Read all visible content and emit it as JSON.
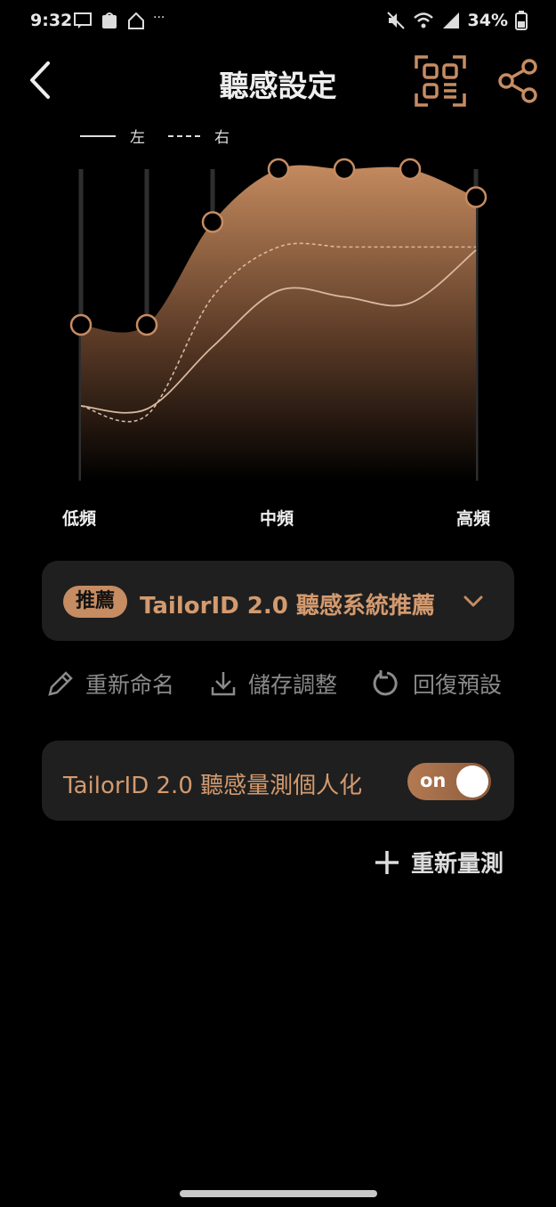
{
  "status_bar": {
    "time": "9:32",
    "ellipsis": "···",
    "battery": "34%"
  },
  "header": {
    "title": "聽感設定"
  },
  "legend": {
    "left": "左",
    "right": "右"
  },
  "chart_labels": {
    "low": "低頻",
    "mid": "中頻",
    "high": "高頻"
  },
  "chart_data": {
    "type": "line",
    "title": "",
    "x": [
      "band1",
      "band2",
      "band3",
      "band4",
      "band5",
      "band6",
      "band7"
    ],
    "bands": 7,
    "ylim": [
      0,
      100
    ],
    "series": [
      {
        "name": "",
        "values": [
          50,
          50,
          83,
          100,
          100,
          100,
          91
        ]
      },
      {
        "name": "左",
        "values": [
          24,
          23,
          43,
          61,
          59,
          57,
          74
        ]
      },
      {
        "name": "右",
        "values": [
          24,
          21,
          59,
          75,
          75,
          75,
          75
        ]
      }
    ]
  },
  "preset": {
    "badge": "推薦",
    "name": "TailorID 2.0 聽感系統推薦"
  },
  "actions": {
    "rename": "重新命名",
    "save": "儲存調整",
    "reset": "回復預設"
  },
  "personalization": {
    "label": "TailorID 2.0 聽感量測個人化",
    "toggle": "on"
  },
  "remeasure": {
    "label": "重新量測"
  },
  "colors": {
    "accent": "#c68c62",
    "card": "#1f1f1f",
    "bg": "#000000"
  }
}
